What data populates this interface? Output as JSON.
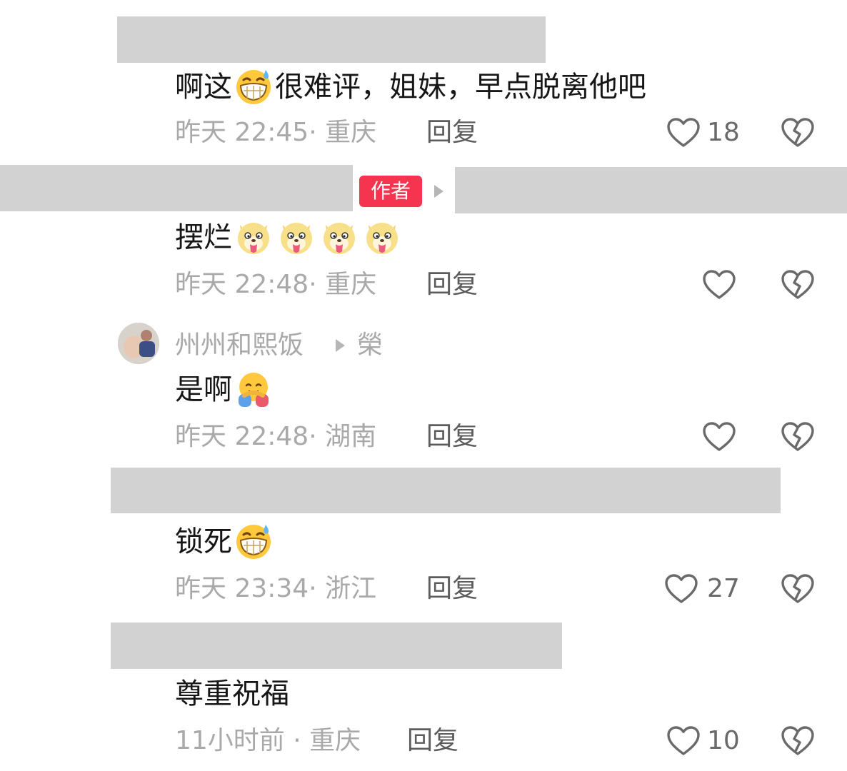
{
  "comments": [
    {
      "text_before": "啊这",
      "emoji": "grinning-sweat-emoji",
      "text_after": "很难评，姐妹，早点脱离他吧",
      "meta": "昨天 22:45· 重庆",
      "reply": "回复",
      "likes": "18"
    },
    {
      "author_badge": "作者",
      "text": "摆烂",
      "emojis": [
        "doge-tongue-emoji",
        "doge-tongue-emoji",
        "doge-tongue-emoji",
        "doge-tongue-emoji"
      ],
      "meta": "昨天 22:48· 重庆",
      "reply": "回复",
      "likes": ""
    },
    {
      "username": "州州和熙饭",
      "reply_to": "榮",
      "text": "是啊",
      "emoji": "hug-emoji",
      "meta": "昨天 22:48· 湖南",
      "reply": "回复",
      "likes": ""
    },
    {
      "text": "锁死",
      "emoji": "grinning-sweat-emoji",
      "meta": "昨天 23:34· 浙江",
      "reply": "回复",
      "likes": "27"
    },
    {
      "text": "尊重祝福",
      "meta": "11小时前 · 重庆",
      "reply": "回复",
      "likes": "10"
    }
  ],
  "colors": {
    "badge": "#f5344f",
    "redaction": "#d2d2d2",
    "meta_text": "#a9a9a9"
  }
}
